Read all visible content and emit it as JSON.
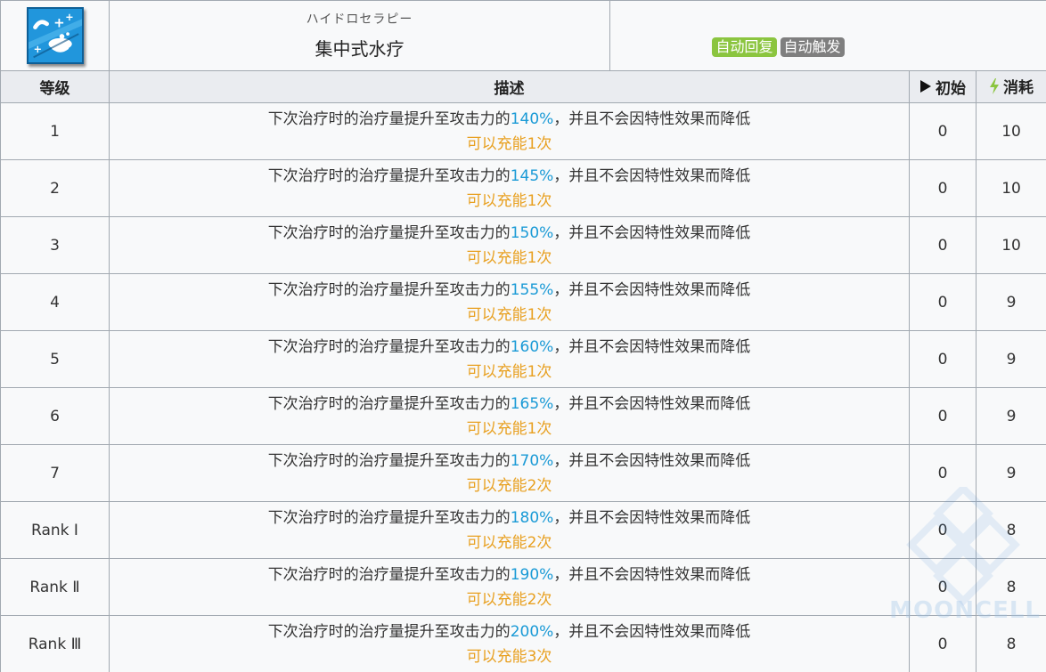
{
  "skill": {
    "name_jp": "ハイドロセラピー",
    "name_cn": "集中式水疗",
    "icon": "skill-icon-water-healing",
    "tags": [
      {
        "label": "自动回复",
        "color": "#8bc53f"
      },
      {
        "label": "自动触发",
        "color": "#7f7f7f"
      }
    ]
  },
  "table": {
    "headers": {
      "level": "等级",
      "description": "描述",
      "initial": "初始",
      "cost": "消耗",
      "initial_icon": "play-triangle-icon",
      "cost_icon": "lightning-icon"
    },
    "desc_prefix": "下次治疗时的治疗量提升至攻击力的",
    "desc_suffix": "，并且不会因特性效果而降低",
    "rows": [
      {
        "level": "1",
        "percent": "140%",
        "charge": "可以充能1次",
        "initial": "0",
        "cost": "10"
      },
      {
        "level": "2",
        "percent": "145%",
        "charge": "可以充能1次",
        "initial": "0",
        "cost": "10"
      },
      {
        "level": "3",
        "percent": "150%",
        "charge": "可以充能1次",
        "initial": "0",
        "cost": "10"
      },
      {
        "level": "4",
        "percent": "155%",
        "charge": "可以充能1次",
        "initial": "0",
        "cost": "9"
      },
      {
        "level": "5",
        "percent": "160%",
        "charge": "可以充能1次",
        "initial": "0",
        "cost": "9"
      },
      {
        "level": "6",
        "percent": "165%",
        "charge": "可以充能1次",
        "initial": "0",
        "cost": "9"
      },
      {
        "level": "7",
        "percent": "170%",
        "charge": "可以充能2次",
        "initial": "0",
        "cost": "9"
      },
      {
        "level": "Rank Ⅰ",
        "percent": "180%",
        "charge": "可以充能2次",
        "initial": "0",
        "cost": "8"
      },
      {
        "level": "Rank Ⅱ",
        "percent": "190%",
        "charge": "可以充能2次",
        "initial": "0",
        "cost": "8"
      },
      {
        "level": "Rank Ⅲ",
        "percent": "200%",
        "charge": "可以充能3次",
        "initial": "0",
        "cost": "8"
      }
    ]
  },
  "watermark": "MOONCELL"
}
